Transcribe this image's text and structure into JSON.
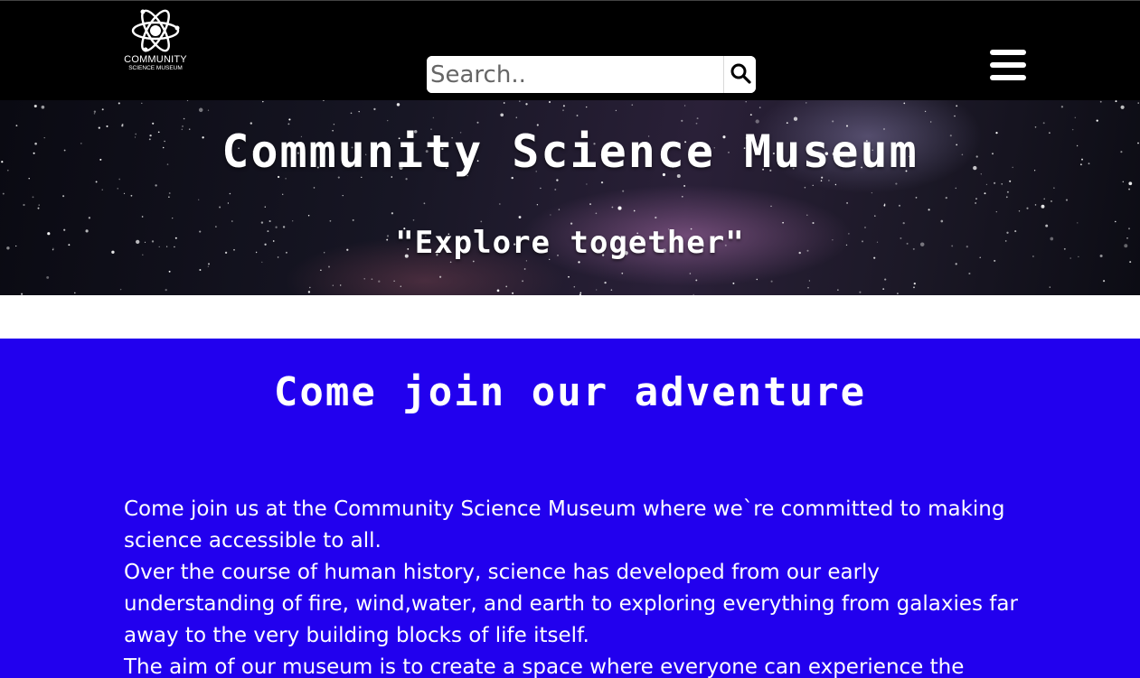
{
  "header": {
    "logo": {
      "line1": "COMMUNITY",
      "line2": "SCIENCE MUSEUM",
      "icon": "atom-icon"
    },
    "search": {
      "placeholder": "Search..",
      "value": "",
      "button_icon": "search-icon"
    },
    "menu_icon": "hamburger-menu-icon"
  },
  "hero": {
    "title": "Community Science Museum",
    "tagline": "\"Explore together\""
  },
  "content": {
    "heading": "Come join our adventure",
    "paragraphs": [
      "Come join us at the Community Science Museum where we`re committed to making science accessible to all.",
      "Over the course of human history, science has developed from our early understanding of fire, wind,water, and earth to exploring everything from galaxies far away to the very building blocks of life itself.",
      "The aim of our museum is to create a space where everyone can experience the"
    ]
  },
  "colors": {
    "navbar_bg": "#000000",
    "content_bg": "#2200ee",
    "text": "#ffffff"
  }
}
